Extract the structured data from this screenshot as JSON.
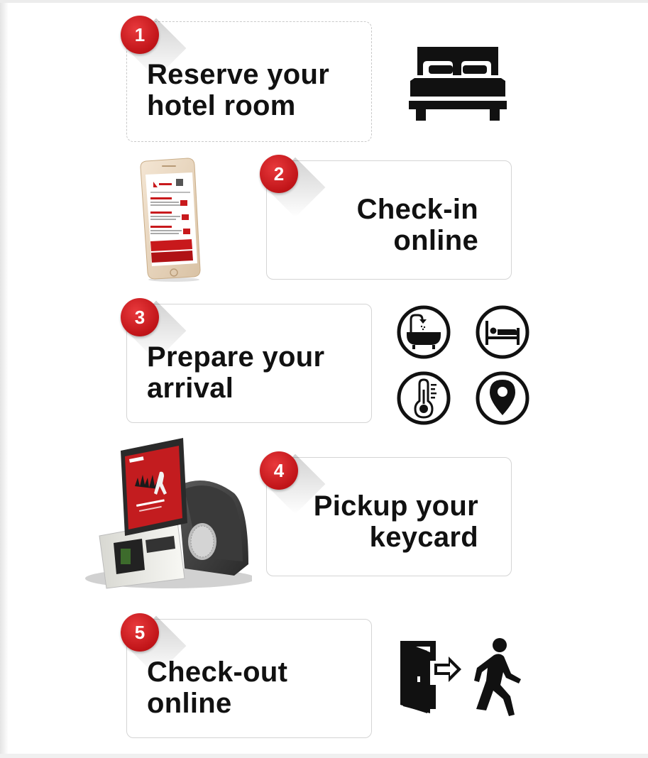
{
  "steps": [
    {
      "number": "1",
      "line1": "Reserve your",
      "line2": "hotel room"
    },
    {
      "number": "2",
      "line1": "Check-in",
      "line2": "online"
    },
    {
      "number": "3",
      "line1": "Prepare your",
      "line2": "arrival"
    },
    {
      "number": "4",
      "line1": "Pickup your",
      "line2": "keycard"
    },
    {
      "number": "5",
      "line1": "Check-out",
      "line2": "online"
    }
  ],
  "icons": {
    "step1": "bed-icon",
    "step2": "smartphone-image",
    "step3": [
      "bathtub-icon",
      "sleeping-bed-icon",
      "thermometer-icon",
      "location-pin-icon"
    ],
    "step4": "kiosk-image",
    "step5": "exit-door-walking-person-icon"
  },
  "colors": {
    "badge": "#c8191c",
    "text": "#111111",
    "card_border": "#d4d4d4"
  }
}
